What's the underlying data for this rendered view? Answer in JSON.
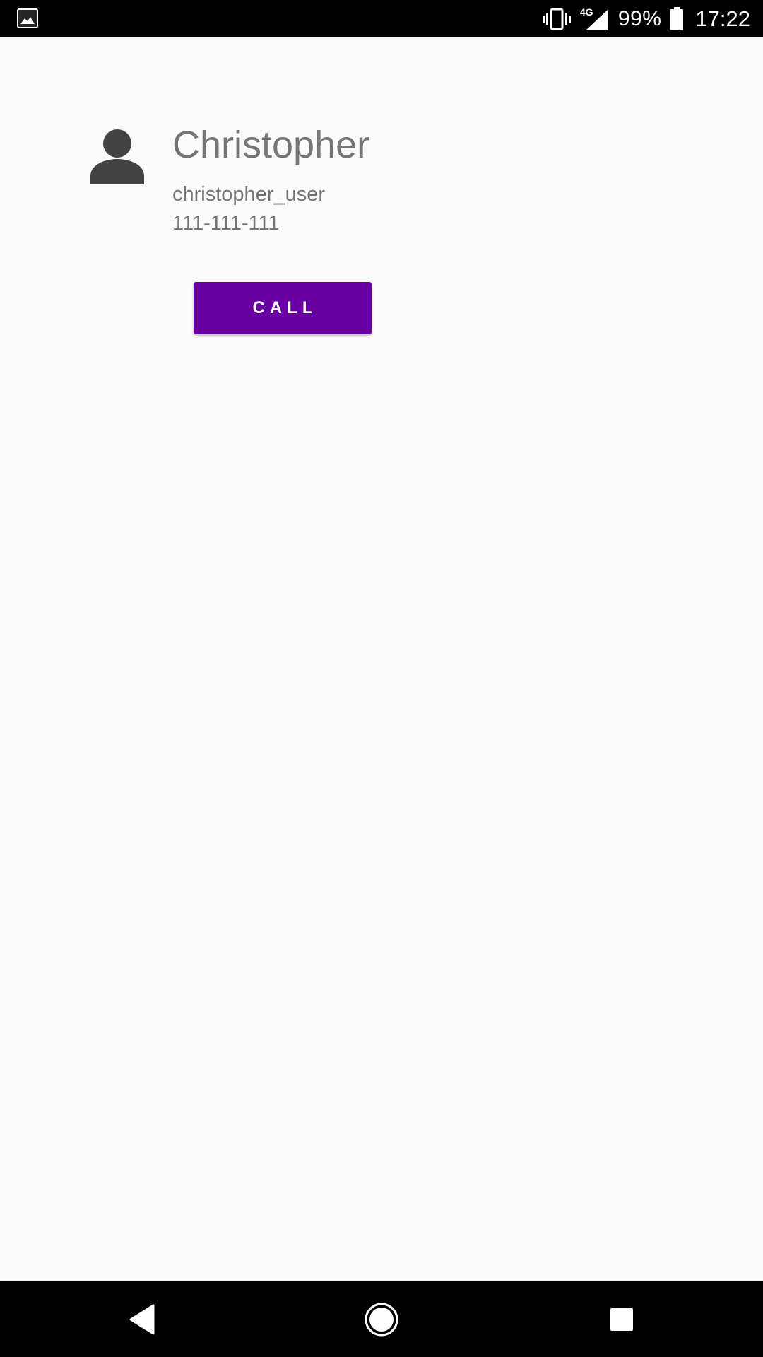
{
  "status_bar": {
    "left_icon": "image-notification-icon",
    "vibrate_icon": "vibrate-icon",
    "network_label": "4G",
    "signal_icon": "signal-icon",
    "battery_percent": "99%",
    "battery_icon": "battery-icon",
    "time": "17:22"
  },
  "contact": {
    "avatar_icon": "person-icon",
    "name": "Christopher",
    "username": "christopher_user",
    "phone": "111-111-111"
  },
  "actions": {
    "call_label": "CALL",
    "call_color": "#6a00a3"
  },
  "nav_bar": {
    "back_icon": "back-triangle-icon",
    "home_icon": "home-circle-icon",
    "recents_icon": "recents-square-icon"
  },
  "colors": {
    "background": "#fafafa",
    "text_secondary": "#757575",
    "system_bars": "#000000"
  }
}
